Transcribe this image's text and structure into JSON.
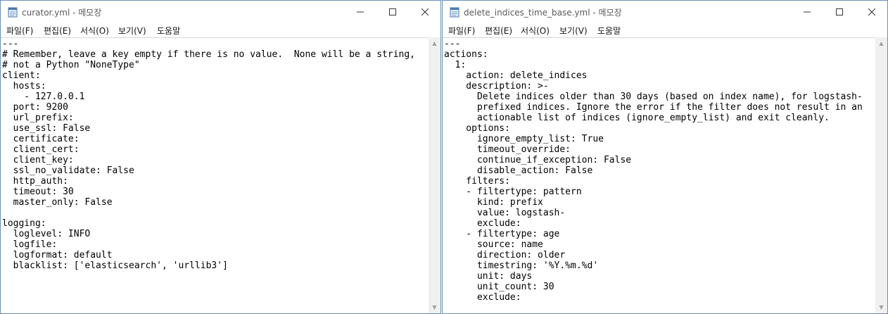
{
  "windows": [
    {
      "title": "curator.yml - 메모장",
      "menu": [
        "파일(F)",
        "편집(E)",
        "서식(O)",
        "보기(V)",
        "도움말"
      ],
      "lines": [
        "---",
        "# Remember, leave a key empty if there is no value.  None will be a string,",
        "# not a Python \"NoneType\"",
        "client:",
        "  hosts:",
        "    - 127.0.0.1",
        "  port: 9200",
        "  url_prefix:",
        "  use_ssl: False",
        "  certificate:",
        "  client_cert:",
        "  client_key:",
        "  ssl_no_validate: False",
        "  http_auth:",
        "  timeout: 30",
        "  master_only: False",
        "",
        "logging:",
        "  loglevel: INFO",
        "  logfile:",
        "  logformat: default",
        "  blacklist: ['elasticsearch', 'urllib3']"
      ]
    },
    {
      "title": "delete_indices_time_base.yml - 메모장",
      "menu": [
        "파일(F)",
        "편집(E)",
        "서식(O)",
        "보기(V)",
        "도움말"
      ],
      "lines": [
        "---",
        "actions:",
        "  1:",
        "    action: delete_indices",
        "    description: >-",
        "      Delete indices older than 30 days (based on index name), for logstash-",
        "      prefixed indices. Ignore the error if the filter does not result in an",
        "      actionable list of indices (ignore_empty_list) and exit cleanly.",
        "    options:",
        "      ignore_empty_list: True",
        "      timeout_override:",
        "      continue_if_exception: False",
        "      disable_action: False",
        "    filters:",
        "    - filtertype: pattern",
        "      kind: prefix",
        "      value: logstash-",
        "      exclude:",
        "    - filtertype: age",
        "      source: name",
        "      direction: older",
        "      timestring: '%Y.%m.%d'",
        "      unit: days",
        "      unit_count: 30",
        "      exclude:"
      ]
    }
  ],
  "icons": {
    "app": "notepad-icon",
    "minimize": "minimize-icon",
    "maximize": "maximize-icon",
    "close": "close-icon",
    "scroll_up": "scroll-up-arrow-icon",
    "scroll_down": "scroll-down-arrow-icon"
  },
  "colors": {
    "border": "#6b8fb9",
    "scrollbar": "#f0f0f0",
    "title_text": "#5a5a5a"
  }
}
